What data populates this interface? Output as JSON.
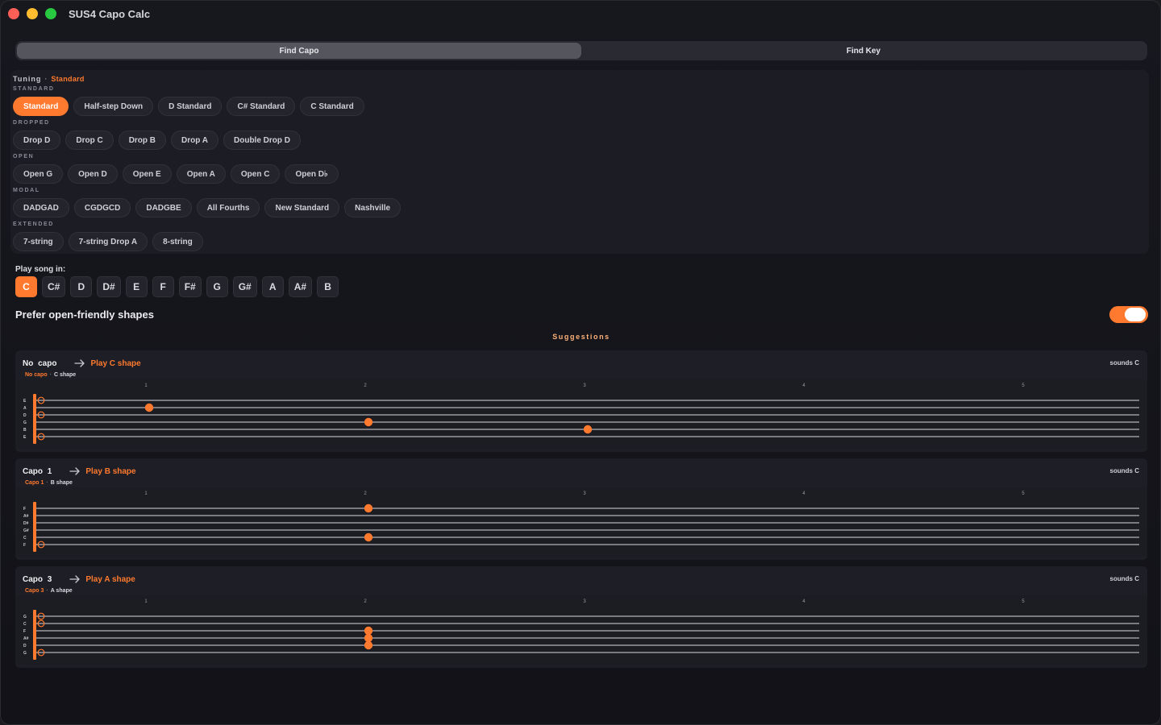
{
  "window": {
    "title": "SUS4 Capo Calc"
  },
  "tabs": [
    {
      "label": "Find Capo",
      "active": true
    },
    {
      "label": "Find Key",
      "active": false
    }
  ],
  "tuning": {
    "header": "Tuning",
    "separator": "·",
    "current": "Standard",
    "groups": [
      {
        "label": "STANDARD",
        "items": [
          "Standard",
          "Half-step Down",
          "D Standard",
          "C# Standard",
          "C Standard"
        ]
      },
      {
        "label": "DROPPED",
        "items": [
          "Drop D",
          "Drop C",
          "Drop B",
          "Drop A",
          "Double Drop D"
        ]
      },
      {
        "label": "OPEN",
        "items": [
          "Open G",
          "Open D",
          "Open E",
          "Open A",
          "Open C",
          "Open D♭"
        ]
      },
      {
        "label": "MODAL",
        "items": [
          "DADGAD",
          "CGDGCD",
          "DADGBE",
          "All Fourths",
          "New Standard",
          "Nashville"
        ]
      },
      {
        "label": "EXTENDED",
        "items": [
          "7-string",
          "7-string Drop A",
          "8-string"
        ]
      }
    ],
    "selected": "Standard"
  },
  "play_in": {
    "label": "Play song in:",
    "keys": [
      "C",
      "C#",
      "D",
      "D#",
      "E",
      "F",
      "F#",
      "G",
      "G#",
      "A",
      "A#",
      "B"
    ],
    "selected": "C"
  },
  "prefer": {
    "label": "Prefer open-friendly shapes",
    "on": true
  },
  "suggestions_title": "Suggestions",
  "accent_color": "#ff7a2e",
  "fret_numbers": [
    "1",
    "2",
    "3",
    "4",
    "5"
  ],
  "cards": [
    {
      "title": "No capo",
      "play": "Play C shape",
      "sounds": "sounds C",
      "sub_capo": "No capo",
      "sub_sep": "·",
      "sub_shape": "C shape",
      "strings": [
        "E",
        "A",
        "D",
        "G",
        "B",
        "E"
      ],
      "open_strings": [
        0,
        2,
        5
      ],
      "notes": [
        {
          "string": 1,
          "fret": 1
        },
        {
          "string": 3,
          "fret": 2
        },
        {
          "string": 4,
          "fret": 3
        }
      ]
    },
    {
      "title": "Capo 1",
      "play": "Play B shape",
      "sounds": "sounds C",
      "sub_capo": "Capo 1",
      "sub_sep": "·",
      "sub_shape": "B shape",
      "strings": [
        "F",
        "A#",
        "D#",
        "G#",
        "C",
        "F"
      ],
      "open_strings": [
        5
      ],
      "notes": [
        {
          "string": 0,
          "fret": 2
        },
        {
          "string": 4,
          "fret": 2
        }
      ]
    },
    {
      "title": "Capo 3",
      "play": "Play A shape",
      "sounds": "sounds C",
      "sub_capo": "Capo 3",
      "sub_sep": "·",
      "sub_shape": "A shape",
      "strings": [
        "G",
        "C",
        "F",
        "A#",
        "D",
        "G"
      ],
      "open_strings": [
        0,
        1,
        5
      ],
      "notes": [
        {
          "string": 2,
          "fret": 2
        },
        {
          "string": 3,
          "fret": 2
        },
        {
          "string": 4,
          "fret": 2
        }
      ]
    }
  ]
}
